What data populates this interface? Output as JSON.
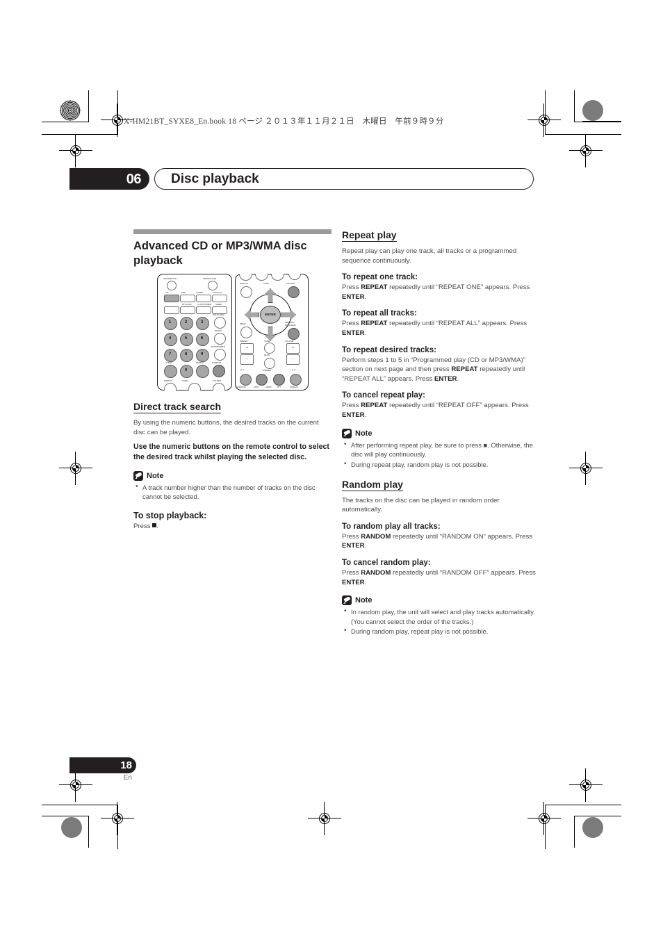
{
  "page": {
    "book_header": "X-HM21BT_SYXE8_En.book  18 ページ  ２０１３年１１月２１日　木曜日　午前９時９分",
    "chapter_number": "06",
    "chapter_title": "Disc playback",
    "page_number": "18",
    "page_language": "En"
  },
  "left_column": {
    "section_title": "Advanced CD or MP3/WMA disc playback",
    "direct_track_search": {
      "heading": "Direct track search",
      "intro": "By using the numeric buttons, the desired tracks on the current disc can be played.",
      "instruction": "Use the numeric buttons on the remote control to select the desired track whilst playing the selected disc.",
      "note_label": "Note",
      "notes": [
        "A track number higher than the number of tracks on the disc cannot be selected."
      ],
      "stop_heading": "To stop playback:",
      "stop_text_prefix": "Press ",
      "stop_text_suffix": "."
    }
  },
  "right_column": {
    "repeat_play": {
      "heading": "Repeat play",
      "intro": "Repeat play can play one track, all tracks or a programmed sequence continuously.",
      "items": [
        {
          "heading": "To repeat one track:",
          "parts": [
            {
              "text": "Press ",
              "bold": false
            },
            {
              "text": "REPEAT",
              "bold": true
            },
            {
              "text": " repeatedly until “REPEAT ONE” appears. Press ",
              "bold": false
            },
            {
              "text": "ENTER",
              "bold": true
            },
            {
              "text": ".",
              "bold": false
            }
          ]
        },
        {
          "heading": "To repeat all tracks:",
          "parts": [
            {
              "text": "Press ",
              "bold": false
            },
            {
              "text": "REPEAT",
              "bold": true
            },
            {
              "text": " repeatedly until “REPEAT ALL” appears. Press ",
              "bold": false
            },
            {
              "text": "ENTER",
              "bold": true
            },
            {
              "text": ".",
              "bold": false
            }
          ]
        },
        {
          "heading": "To repeat desired tracks:",
          "parts": [
            {
              "text": "Perform steps 1 to 5 in “Programmed play (CD or MP3/WMA)” section on next page and then press ",
              "bold": false
            },
            {
              "text": "REPEAT",
              "bold": true
            },
            {
              "text": " repeatedly until “REPEAT ALL” appears. Press ",
              "bold": false
            },
            {
              "text": "ENTER",
              "bold": true
            },
            {
              "text": ".",
              "bold": false
            }
          ]
        },
        {
          "heading": "To cancel repeat play:",
          "parts": [
            {
              "text": "Press ",
              "bold": false
            },
            {
              "text": "REPEAT",
              "bold": true
            },
            {
              "text": " repeatedly until “REPEAT OFF” appears. Press ",
              "bold": false
            },
            {
              "text": "ENTER",
              "bold": true
            },
            {
              "text": ".",
              "bold": false
            }
          ]
        }
      ],
      "note_label": "Note",
      "notes": [
        "After performing repeat play, be sure to press ■. Otherwise, the disc will play continuously.",
        "During repeat play, random play is not possible."
      ]
    },
    "random_play": {
      "heading": "Random play",
      "intro": "The tracks on the disc can be played in random order automatically.",
      "items": [
        {
          "heading": "To random play all tracks:",
          "parts": [
            {
              "text": "Press ",
              "bold": false
            },
            {
              "text": "RANDOM",
              "bold": true
            },
            {
              "text": " repeatedly until “RANDOM ON” appears. Press ",
              "bold": false
            },
            {
              "text": "ENTER",
              "bold": true
            },
            {
              "text": ".",
              "bold": false
            }
          ]
        },
        {
          "heading": "To cancel random play:",
          "parts": [
            {
              "text": "Press ",
              "bold": false
            },
            {
              "text": "RANDOM",
              "bold": true
            },
            {
              "text": " repeatedly until “RANDOM OFF” appears. Press ",
              "bold": false
            },
            {
              "text": "ENTER",
              "bold": true
            },
            {
              "text": ".",
              "bold": false
            }
          ]
        }
      ],
      "note_label": "Note",
      "notes": [
        "In random play, the unit will select and play tracks automatically. (You cannot select the order of the tracks.)",
        "During random play, repeat play is not possible."
      ]
    }
  },
  "remote_control": {
    "labels_left": [
      "STANDBY/ON",
      "OPEN/CLOSE",
      "CD",
      "USB",
      "TUNER",
      "AUDIO IN",
      "BT AUDIO",
      "CLOCK/TIMER",
      "SLEEP",
      "EQUALIZER",
      "P.BASS",
      "BASS/TREBLE",
      "CLEAR",
      "REPEAT",
      "RANDOM",
      "DISPLAY",
      "TUNE+",
      "FOLDER"
    ],
    "numeric_keys": [
      "1",
      "2",
      "3",
      "4",
      "5",
      "6",
      "7",
      "8",
      "9",
      "0"
    ],
    "labels_right": [
      "DISPLAY",
      "TUNE+",
      "FOLDER",
      "ENTER",
      "MENU",
      "MEMORY/PROGRAM",
      "PRESET",
      "TUNE-",
      "VOLUME",
      "MUTE",
      "DIMMER",
      "ST/MONO",
      "RDS",
      "ASPM",
      "PTY",
      "DISPLAY"
    ]
  },
  "colors": {
    "ink": "#231f20",
    "body_text": "#4a4a4a",
    "rule": "#9a9a9a",
    "button_fill": "#a6a6a6"
  }
}
